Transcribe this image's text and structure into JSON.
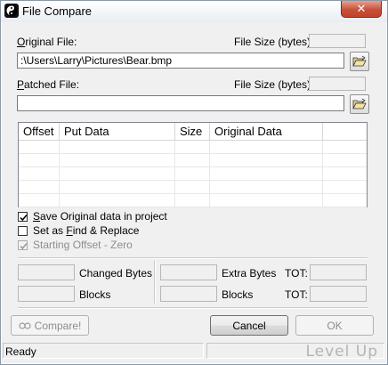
{
  "window": {
    "title": "File Compare",
    "close_glyph": "✕"
  },
  "original": {
    "label_prefix": "",
    "label_access": "O",
    "label_rest": "riginal File:",
    "size_label": "File Size (bytes):",
    "path": ":\\Users\\Larry\\Pictures\\Bear.bmp",
    "size_value": ""
  },
  "patched": {
    "label_access": "P",
    "label_rest": "atched File:",
    "size_label": "File Size (bytes):",
    "path": "",
    "size_value": ""
  },
  "grid": {
    "columns": [
      "Offset",
      "Put Data",
      "Size",
      "Original Data"
    ],
    "rows": []
  },
  "options": {
    "save_original": {
      "access": "S",
      "rest": "ave Original data in project",
      "checked": true,
      "enabled": true
    },
    "find_replace": {
      "prefix": "Set as ",
      "access": "F",
      "rest": "ind & Replace",
      "checked": false,
      "enabled": true
    },
    "starting_offset": {
      "access": "",
      "rest": "Starting Offset - Zero",
      "checked": true,
      "enabled": false
    }
  },
  "stats": {
    "changed_bytes_label": "Changed Bytes",
    "blocks_label_left": "Blocks",
    "extra_bytes_label": "Extra Bytes",
    "blocks_label_right": "Blocks",
    "tot_label_1": "TOT:",
    "tot_label_2": "TOT:"
  },
  "buttons": {
    "compare": "Compare!",
    "cancel": "Cancel",
    "ok": "OK"
  },
  "status": {
    "text": "Ready",
    "watermark": "Level Up"
  },
  "icons": {
    "app": "yin-yang-icon",
    "browse": "open-folder-icon",
    "compare": "compare-icon",
    "close": "close-icon"
  }
}
